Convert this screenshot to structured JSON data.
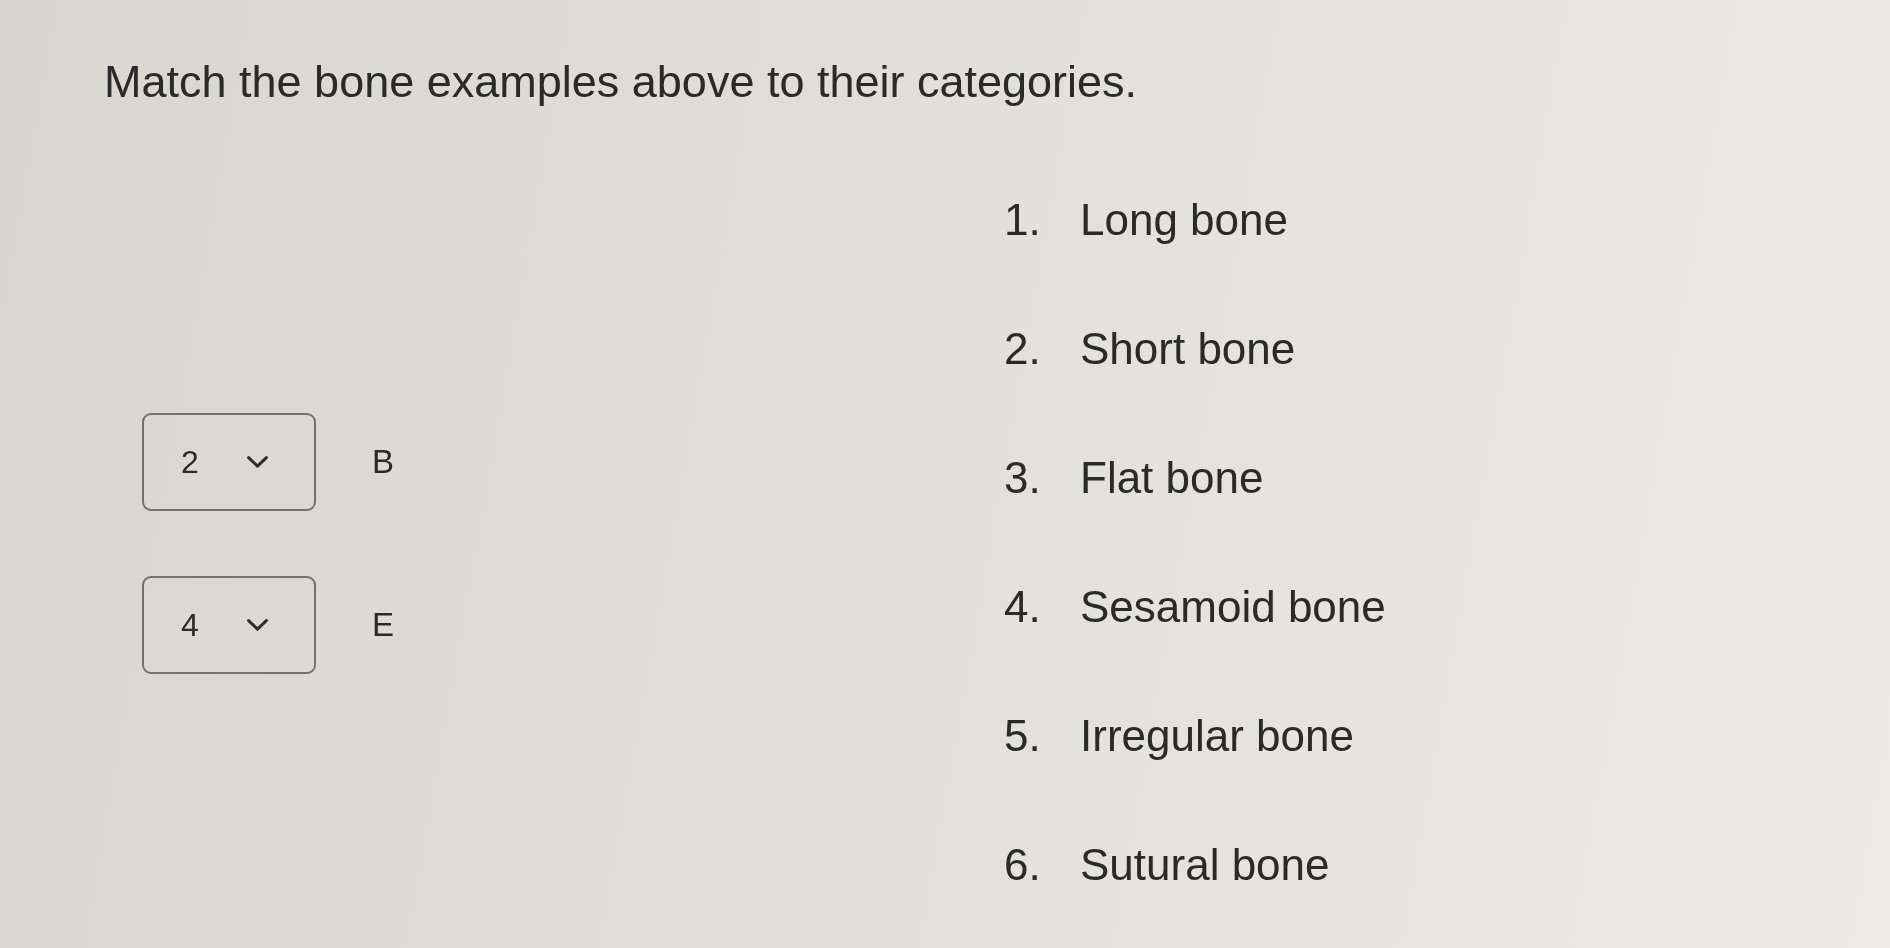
{
  "prompt": "Match the bone examples above to their categories.",
  "matches": [
    {
      "selected_value": "2",
      "example": "B"
    },
    {
      "selected_value": "4",
      "example": "E"
    }
  ],
  "categories": [
    {
      "number": "1.",
      "label": "Long bone"
    },
    {
      "number": "2.",
      "label": "Short bone"
    },
    {
      "number": "3.",
      "label": "Flat bone"
    },
    {
      "number": "4.",
      "label": "Sesamoid bone"
    },
    {
      "number": "5.",
      "label": "Irregular bone"
    },
    {
      "number": "6.",
      "label": "Sutural bone"
    }
  ]
}
